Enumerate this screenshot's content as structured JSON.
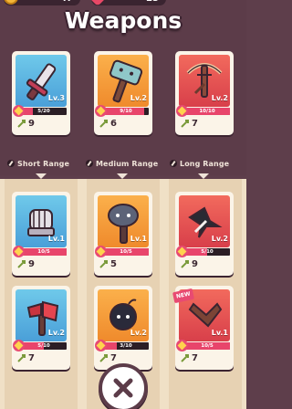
{
  "header": {
    "coins": "47",
    "gems": "25",
    "title": "Weapons"
  },
  "equipped": [
    {
      "weapon": "sword",
      "icon": "sword-icon",
      "color": "blue",
      "level": "Lv.3",
      "progress": "5/20",
      "progress_fraction": 0.25,
      "power": "9"
    },
    {
      "weapon": "hammer",
      "icon": "hammer-icon",
      "color": "orange",
      "level": "Lv.2",
      "progress": "9/10",
      "progress_fraction": 0.9,
      "power": "6"
    },
    {
      "weapon": "crossbow",
      "icon": "crossbow-icon",
      "color": "red",
      "level": "Lv.2",
      "progress": "10/10",
      "progress_fraction": 1.0,
      "power": "7"
    }
  ],
  "categories": [
    {
      "label": "Short Range",
      "icon": "dagger-icon"
    },
    {
      "label": "Medium Range",
      "icon": "dagger-icon"
    },
    {
      "label": "Long Range",
      "icon": "dagger-icon"
    }
  ],
  "inventory": [
    {
      "weapon": "gauntlet",
      "icon": "gauntlet-icon",
      "color": "blue",
      "level": "Lv.1",
      "progress": "10/5",
      "progress_fraction": 1.0,
      "power": "9"
    },
    {
      "weapon": "mace",
      "icon": "mace-icon",
      "color": "orange",
      "level": "Lv.1",
      "progress": "10/5",
      "progress_fraction": 1.0,
      "power": "5"
    },
    {
      "weapon": "shuriken",
      "icon": "shuriken-icon",
      "color": "red",
      "level": "Lv.2",
      "progress": "5/10",
      "progress_fraction": 0.5,
      "power": "9"
    },
    {
      "weapon": "axe",
      "icon": "axe-icon",
      "color": "blue",
      "level": "Lv.2",
      "progress": "5/10",
      "progress_fraction": 0.5,
      "power": "7"
    },
    {
      "weapon": "bomb",
      "icon": "bomb-icon",
      "color": "orange",
      "level": "Lv.2",
      "progress": "3/10",
      "progress_fraction": 0.3,
      "power": "7"
    },
    {
      "weapon": "boomerang",
      "icon": "boomerang-icon",
      "color": "red",
      "level": "Lv.1",
      "progress": "10/5",
      "progress_fraction": 1.0,
      "power": "7",
      "badge": "NEW"
    }
  ],
  "colors": {
    "background": "#5c3c49",
    "panel": "#f0e0c6",
    "card": "#fbf4e8",
    "progress": "#e8456b",
    "blue": "#4a9fd8",
    "orange": "#ef8a2c",
    "red": "#d83f4a"
  },
  "footer": {
    "close_icon": "close-icon"
  }
}
